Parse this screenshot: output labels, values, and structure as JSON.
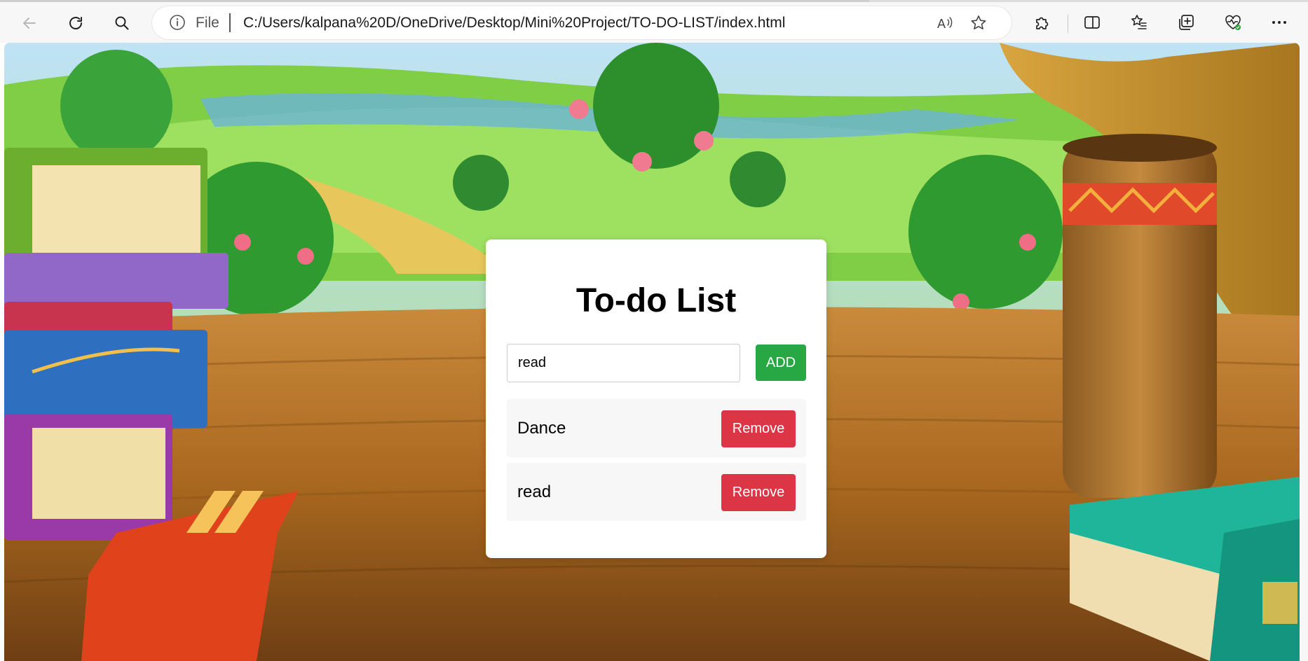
{
  "browser": {
    "address": {
      "scheme_label": "File",
      "url": "C:/Users/kalpana%20D/OneDrive/Desktop/Mini%20Project/TO-DO-LIST/index.html"
    },
    "icons": {
      "back": "back-arrow-icon",
      "refresh": "refresh-icon",
      "search": "search-icon",
      "info": "info-icon",
      "read_aloud": "read-aloud-icon",
      "favorite": "star-icon",
      "extensions": "puzzle-icon",
      "split_screen": "split-screen-icon",
      "favorites": "favorites-list-icon",
      "collections": "collections-icon",
      "performance": "heart-pulse-icon",
      "more": "more-dots-icon"
    },
    "colors": {
      "toolbar": "#f7f7f7",
      "address_bg": "#ffffff"
    }
  },
  "app": {
    "title": "To-do List",
    "input": {
      "value": "read",
      "placeholder": ""
    },
    "add_label": "ADD",
    "items": [
      {
        "text": "Dance",
        "remove_label": "Remove"
      },
      {
        "text": "read",
        "remove_label": "Remove"
      }
    ],
    "colors": {
      "add": "#28a745",
      "remove": "#dc3545",
      "card": "#ffffff",
      "item_bg": "#f7f7f7"
    }
  },
  "background": {
    "description_icon": "cartoon-scene-illustration"
  }
}
